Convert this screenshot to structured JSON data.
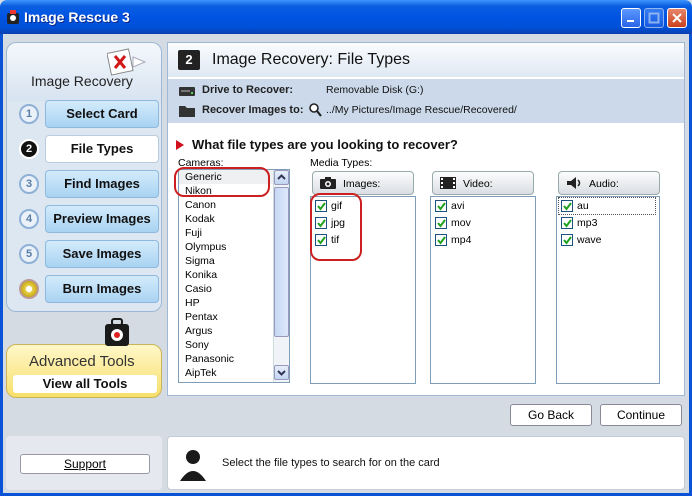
{
  "window": {
    "title": "Image Rescue 3"
  },
  "nav": {
    "title": "Image Recovery",
    "steps": [
      {
        "num": "1",
        "label": "Select Card"
      },
      {
        "num": "2",
        "label": "File Types"
      },
      {
        "num": "3",
        "label": "Find Images"
      },
      {
        "num": "4",
        "label": "Preview Images"
      },
      {
        "num": "5",
        "label": "Save Images"
      },
      {
        "num": "",
        "label": "Burn Images"
      }
    ]
  },
  "advanced": {
    "title": "Advanced Tools",
    "button": "View all Tools"
  },
  "support": {
    "label": "Support"
  },
  "main": {
    "step_num": "2",
    "title": "Image Recovery: File Types",
    "drive_label": "Drive to Recover:",
    "drive_value": "Removable Disk (G:)",
    "recover_label": "Recover Images to:",
    "recover_value": "../My Pictures/Image Rescue/Recovered/",
    "question": "What file types are you looking to recover?"
  },
  "cameras": {
    "label": "Cameras:",
    "items": [
      "Generic",
      "Nikon",
      "Canon",
      "Kodak",
      "Fuji",
      "Olympus",
      "Sigma",
      "Konika",
      "Casio",
      "HP",
      "Pentax",
      "Argus",
      "Sony",
      "Panasonic",
      "AipTek"
    ]
  },
  "media": {
    "label": "Media Types:",
    "images": {
      "label": "Images:",
      "items": [
        "gif",
        "jpg",
        "tif"
      ]
    },
    "video": {
      "label": "Video:",
      "items": [
        "avi",
        "mov",
        "mp4"
      ]
    },
    "audio": {
      "label": "Audio:",
      "items": [
        "au",
        "mp3",
        "wave"
      ]
    }
  },
  "buttons": {
    "back": "Go Back",
    "continue": "Continue"
  },
  "status": {
    "text": "Select the file types to search for on the card"
  },
  "colors": {
    "titlebar": "#0054e3",
    "accent_red": "#cc2020",
    "step_button": "#a9d3f2",
    "advanced": "#f7df6a"
  }
}
